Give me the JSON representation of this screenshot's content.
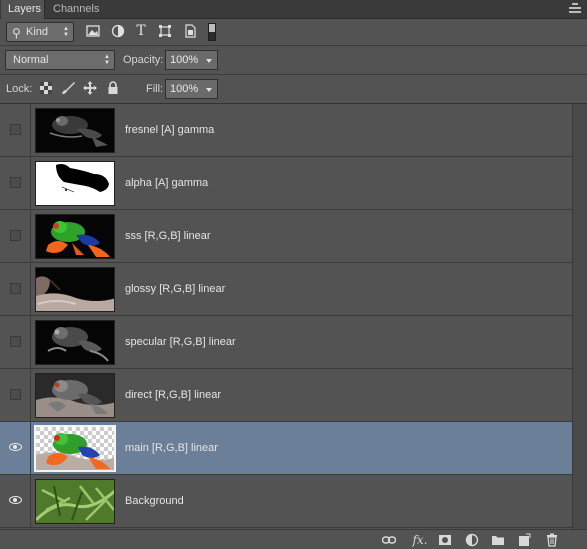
{
  "tabs": [
    {
      "label": "Layers",
      "active": true
    },
    {
      "label": "Channels",
      "active": false
    }
  ],
  "filter": {
    "kind_label": "Kind",
    "icons": [
      "image-filter-icon",
      "adjustment-filter-icon",
      "type-filter-icon",
      "shape-filter-icon",
      "smart-object-filter-icon"
    ]
  },
  "blend": {
    "mode": "Normal",
    "opacity_label": "Opacity:",
    "opacity_value": "100%"
  },
  "lock": {
    "label": "Lock:",
    "fill_label": "Fill:",
    "fill_value": "100%"
  },
  "layers": [
    {
      "name": "fresnel [A] gamma",
      "visible": false,
      "selected": false
    },
    {
      "name": "alpha [A] gamma",
      "visible": false,
      "selected": false
    },
    {
      "name": "sss [R,G,B] linear",
      "visible": false,
      "selected": false
    },
    {
      "name": "glossy [R,G,B] linear",
      "visible": false,
      "selected": false
    },
    {
      "name": "specular [R,G,B] linear",
      "visible": false,
      "selected": false
    },
    {
      "name": "direct [R,G,B] linear",
      "visible": false,
      "selected": false
    },
    {
      "name": "main [R,G,B] linear",
      "visible": true,
      "selected": true
    },
    {
      "name": "Background",
      "visible": true,
      "selected": false
    }
  ],
  "bottom_icons": [
    "link-layers-icon",
    "fx-icon",
    "layer-mask-icon",
    "adjustment-layer-icon",
    "new-group-icon",
    "new-layer-icon",
    "delete-layer-icon"
  ],
  "colors": {
    "panel_bg": "#535353",
    "selected_row": "#6b7f99",
    "tab_bar": "#3a3a3a"
  }
}
